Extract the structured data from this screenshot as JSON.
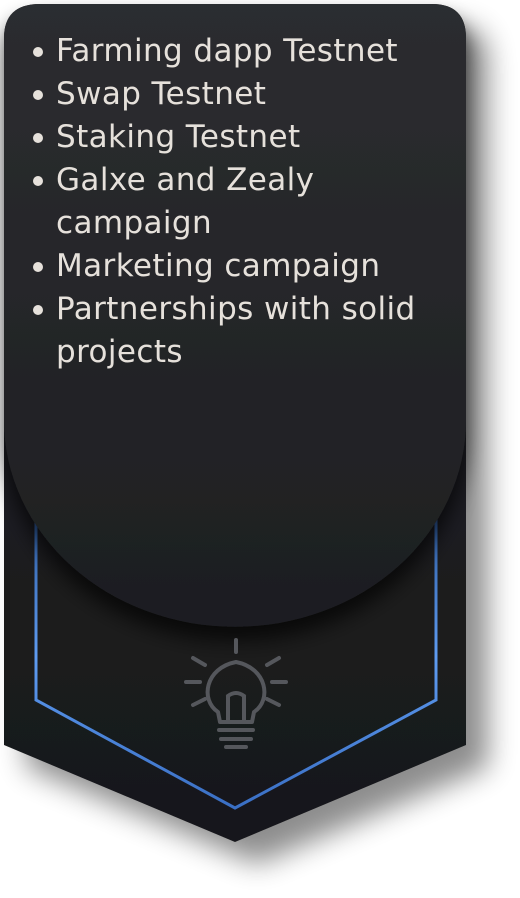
{
  "features": [
    "Farming dapp Testnet",
    "Swap Testnet",
    "Staking Testnet",
    "Galxe and Zealy campaign",
    "Marketing campaign",
    "Partnerships with solid projects"
  ],
  "icon": "lightbulb-icon",
  "colors": {
    "card": "#1f2023",
    "text": "#e6e1db",
    "accent_border": "#4a82d6",
    "icon": "#55575c"
  }
}
